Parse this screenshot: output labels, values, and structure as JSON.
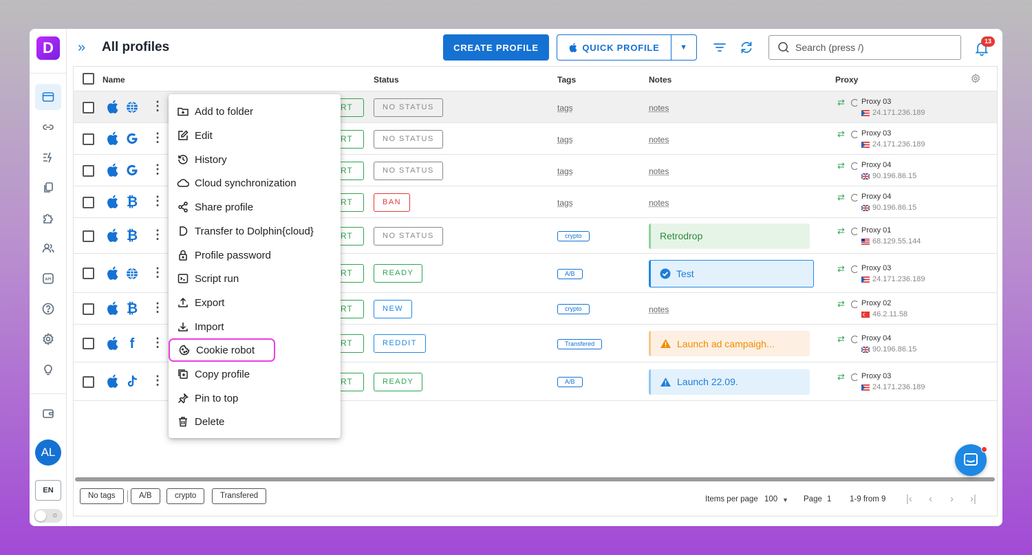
{
  "app": {
    "logo_letter": "D",
    "avatar_initials": "AL",
    "language": "EN"
  },
  "header": {
    "title": "All profiles",
    "create_button": "CREATE PROFILE",
    "quick_button": "QUICK PROFILE",
    "search_placeholder": "Search (press /)",
    "notification_count": "13"
  },
  "table": {
    "columns": {
      "name": "Name",
      "status": "Status",
      "tags": "Tags",
      "notes": "Notes",
      "proxy": "Proxy"
    },
    "start_label": "RT",
    "rows": [
      {
        "site": "globe",
        "status": "NO STATUS",
        "tags": "tags",
        "notes": "notes",
        "proxy": "Proxy 03",
        "ip": "24.171.236.189",
        "flag": "pr"
      },
      {
        "site": "G",
        "status": "NO STATUS",
        "tags": "tags",
        "notes": "notes",
        "proxy": "Proxy 03",
        "ip": "24.171.236.189",
        "flag": "pr"
      },
      {
        "site": "G",
        "status": "NO STATUS",
        "tags": "tags",
        "notes": "notes",
        "proxy": "Proxy 04",
        "ip": "90.196.86.15",
        "flag": "uk"
      },
      {
        "site": "btc",
        "status": "BAN",
        "tags": "tags",
        "notes": "notes",
        "proxy": "Proxy 04",
        "ip": "90.196.86.15",
        "flag": "uk"
      },
      {
        "site": "btc",
        "status": "NO STATUS",
        "tags": "crypto",
        "notes": "Retrodrop",
        "proxy": "Proxy 01",
        "ip": "68.129.55.144",
        "flag": "us"
      },
      {
        "site": "globe",
        "status": "READY",
        "tags": "A/B",
        "notes": "Test",
        "proxy": "Proxy 03",
        "ip": "24.171.236.189",
        "flag": "pr"
      },
      {
        "site": "btc",
        "status": "NEW",
        "tags": "crypto",
        "notes": "notes",
        "proxy": "Proxy 02",
        "ip": "46.2.11.58",
        "flag": "tr"
      },
      {
        "site": "f",
        "status": "REDDIT",
        "tags": "Transfered",
        "notes": "Launch ad campaigh...",
        "proxy": "Proxy 04",
        "ip": "90.196.86.15",
        "flag": "uk"
      },
      {
        "site": "tiktok",
        "status": "READY",
        "tags": "A/B",
        "notes": "Launch 22.09.",
        "proxy": "Proxy 03",
        "ip": "24.171.236.189",
        "flag": "pr"
      }
    ]
  },
  "context_menu": {
    "items": [
      "Add to folder",
      "Edit",
      "History",
      "Cloud synchronization",
      "Share profile",
      "Transfer to Dolphin{cloud}",
      "Profile password",
      "Script run",
      "Export",
      "Import",
      "Cookie robot",
      "Copy profile",
      "Pin to top",
      "Delete"
    ],
    "highlighted": "Cookie robot"
  },
  "footer": {
    "tag_filters": [
      "No tags",
      "A/B",
      "crypto",
      "Transfered"
    ],
    "items_per_page_label": "Items per page",
    "items_per_page": "100",
    "page_label": "Page",
    "page": "1",
    "range": "1-9 from 9"
  },
  "colors": {
    "primary": "#1572d3",
    "green": "#2ea44f",
    "red": "#e53935",
    "highlight": "#ea3fe8"
  }
}
